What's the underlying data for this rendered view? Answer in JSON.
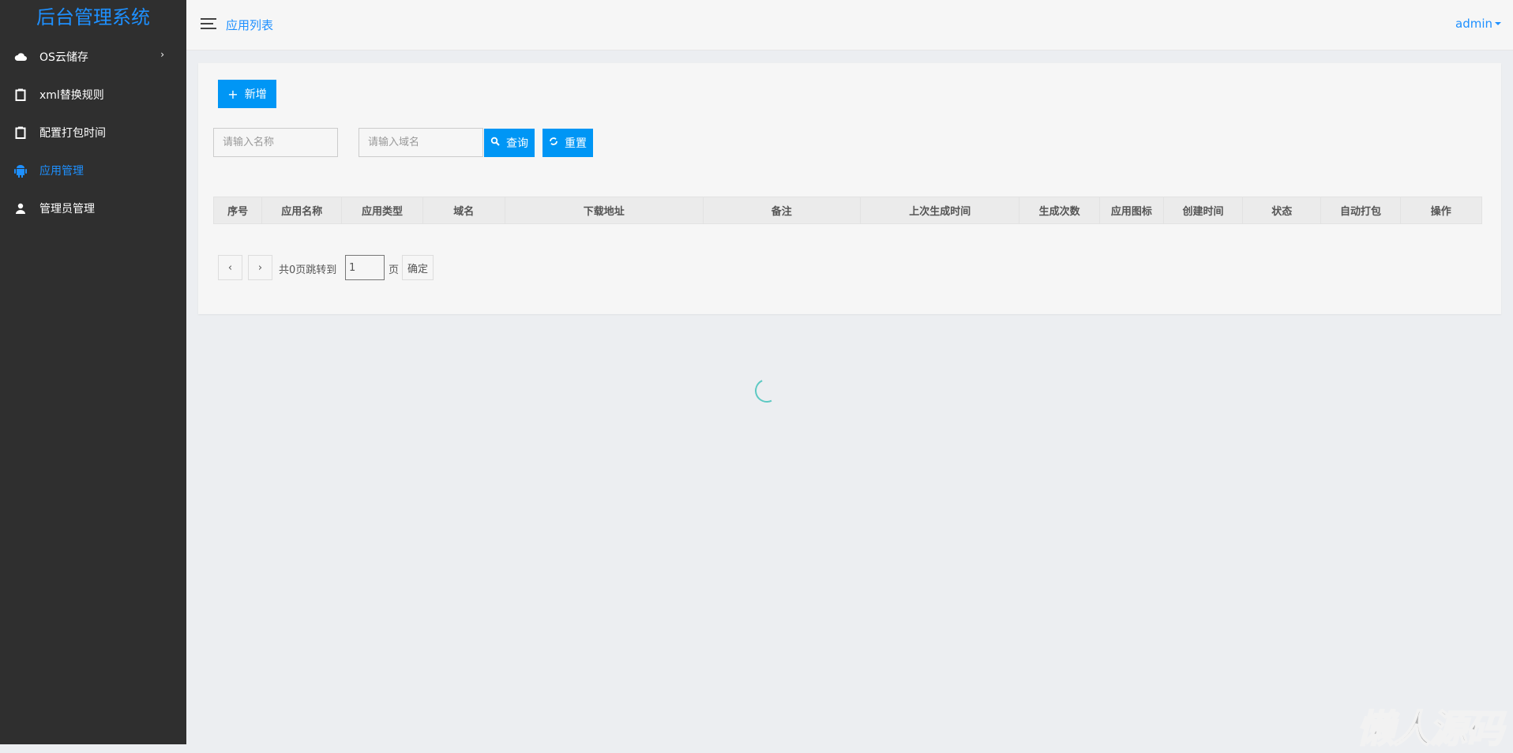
{
  "sidebar": {
    "title": "后台管理系统",
    "items": [
      {
        "label": "OS云储存",
        "icon": "cloud-icon"
      },
      {
        "label": "xml替换规则",
        "icon": "clipboard-icon"
      },
      {
        "label": "配置打包时间",
        "icon": "clipboard-icon"
      },
      {
        "label": "应用管理",
        "icon": "android-icon",
        "active": true
      },
      {
        "label": "管理员管理",
        "icon": "user-icon"
      }
    ]
  },
  "header": {
    "breadcrumb": "应用列表",
    "user": "admin"
  },
  "toolbar": {
    "add_label": "新增",
    "name_placeholder": "请输入名称",
    "domain_placeholder": "请输入域名",
    "query_label": "查询",
    "reset_label": "重置"
  },
  "table": {
    "columns": [
      "序号",
      "应用名称",
      "应用类型",
      "域名",
      "下载地址",
      "备注",
      "上次生成时间",
      "生成次数",
      "应用图标",
      "创建时间",
      "状态",
      "自动打包",
      "操作"
    ]
  },
  "pagination": {
    "prev": "‹",
    "next": "›",
    "total_text": "共0页跳转到",
    "page_value": "1",
    "page_unit": "页",
    "confirm": "确定"
  },
  "watermark": "懒人源码",
  "colors": {
    "accent": "#0096f5",
    "sidebar": "#2f2f2f"
  }
}
